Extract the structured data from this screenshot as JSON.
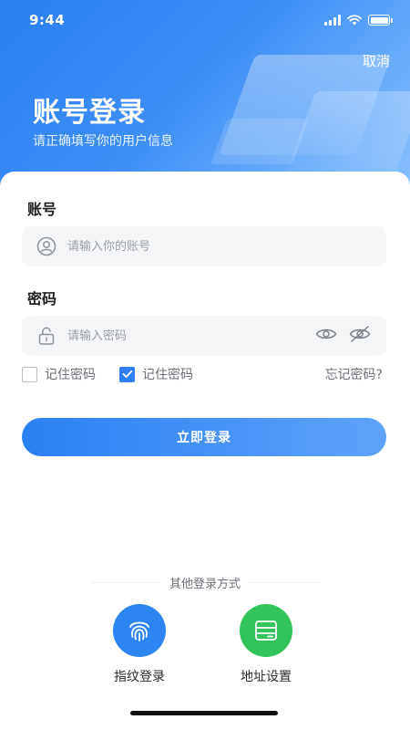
{
  "status_bar": {
    "time": "9:44"
  },
  "header": {
    "cancel_label": "取消",
    "title": "账号登录",
    "subtitle": "请正确填写你的用户信息"
  },
  "form": {
    "account_label": "账号",
    "account_placeholder": "请输入你的账号",
    "account_value": "",
    "password_label": "密码",
    "password_placeholder": "请输入密码",
    "password_value": "",
    "remember_unchecked_label": "记住密码",
    "remember_checked_label": "记住密码",
    "forgot_label": "忘记密码?",
    "login_button_label": "立即登录"
  },
  "other_login": {
    "divider_text": "其他登录方式",
    "fingerprint_label": "指纹登录",
    "address_label": "地址设置"
  },
  "colors": {
    "primary": "#2f7ff3",
    "fingerprint_bg": "#2c85f2",
    "address_bg": "#32c458"
  },
  "icons": {
    "account": "user-circle-icon",
    "password": "lock-icon",
    "show_password": "eye-icon",
    "hide_password": "eye-off-icon",
    "fingerprint": "fingerprint-icon",
    "address": "server-icon"
  }
}
